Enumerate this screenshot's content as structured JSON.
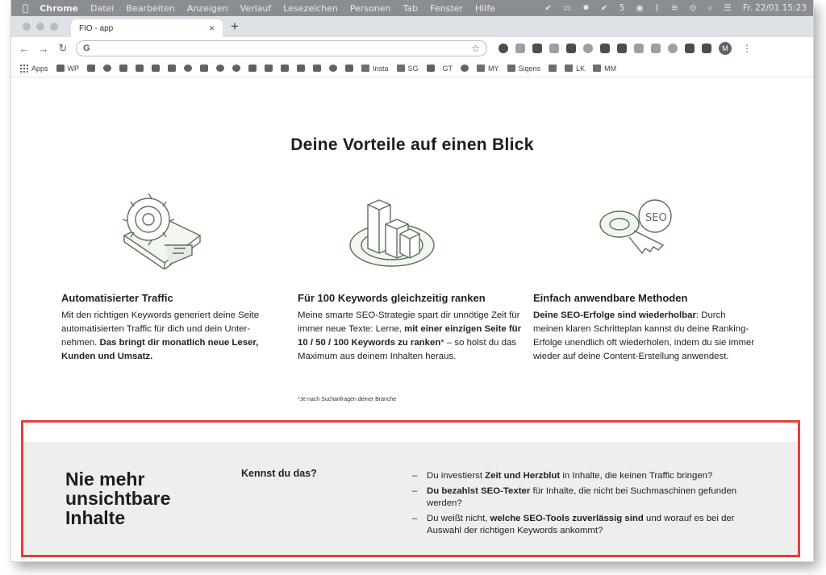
{
  "menubar": {
    "app": "Chrome",
    "items": [
      "Datei",
      "Bearbeiten",
      "Anzeigen",
      "Verlauf",
      "Lesezeichen",
      "Personen",
      "Tab",
      "Fenster",
      "Hilfe"
    ],
    "status_count": "5",
    "clock": "Fr. 22/01  15:23"
  },
  "tab": {
    "title": "FIO - app",
    "close": "×",
    "new": "+"
  },
  "toolbar": {
    "address_value": "",
    "account_initial": "M"
  },
  "bookmarks": [
    "Apps",
    "WP",
    "Insta",
    "SG",
    "GT",
    "MY",
    "Siqens",
    "LK",
    "MM"
  ],
  "page": {
    "headline": "Deine Vorteile auf einen Blick",
    "columns": [
      {
        "title": "Automatisierter Traffic",
        "text_1": "Mit den richtigen Keywords generiert deine Seite automatisierten Traffic für dich und dein Unter-nehmen. ",
        "text_bold": "Das bringt dir monatlich neue Leser, Kunden und Umsatz.",
        "icon": "gear-icon"
      },
      {
        "title": "Für 100 Keywords gleichzeitig ranken",
        "text_1": "Meine smarte SEO-Strategie spart dir unnötige Zeit für immer neue Texte: Lerne, ",
        "text_bold": "mit einer einzigen Seite für 10 / 50 / 100 Keywords zu ranken",
        "text_2": "* – so holst du das Maximum aus deinem Inhalten heraus.",
        "icon": "bar-chart-icon"
      },
      {
        "title": "Einfach anwendbare Methoden",
        "text_bold": "Deine SEO-Erfolge sind wiederholbar",
        "text_1": ": Durch meinen klaren Schritteplan kannst du deine Ranking-Erfolge unendlich oft wiederholen, indem du sie immer wieder auf deine Content-Erstellung anwendest.",
        "icon": "seo-key-icon"
      }
    ],
    "footnote": "*Je nach Suchanfragen deiner Branche"
  },
  "band": {
    "title": "Nie mehr unsichtbare Inhalte",
    "question": "Kennst du das?",
    "items": [
      {
        "pre": "Du investierst ",
        "bold": "Zeit und Herzblut",
        "post": " in Inhalte, die keinen Traffic bringen?"
      },
      {
        "pre": "",
        "bold": "Du bezahlst SEO-Texter",
        "post": " für Inhalte, die nicht bei Suchmaschinen gefunden werden?"
      },
      {
        "pre": "Du weißt nicht, ",
        "bold": "welche SEO-Tools zuverlässig sind",
        "post": " und worauf es bei der Auswahl der richtigen Keywords ankommt?"
      }
    ],
    "highlight_color": "#e5403a"
  }
}
